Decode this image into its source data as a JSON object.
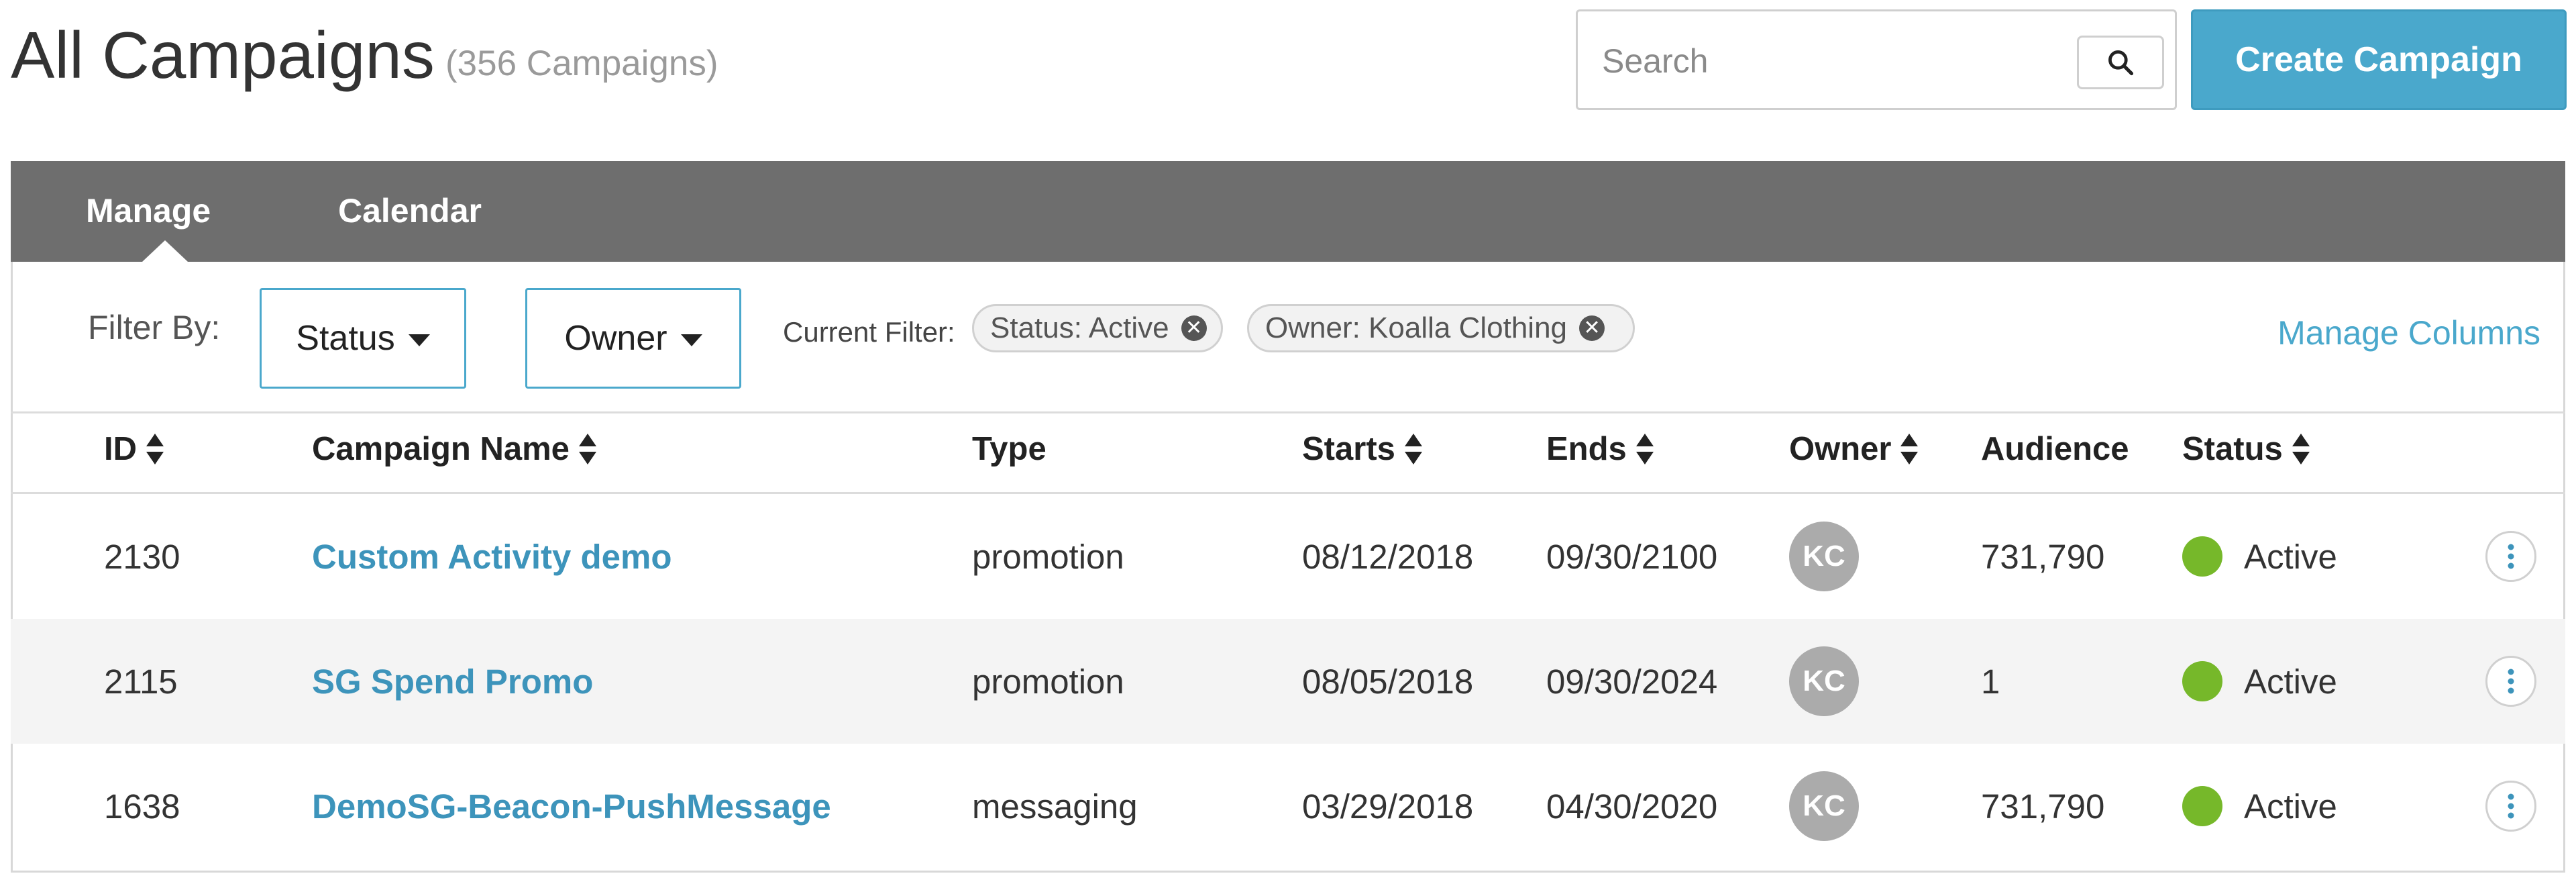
{
  "header": {
    "title": "All Campaigns",
    "count": "(356 Campaigns)",
    "search": {
      "placeholder": "Search",
      "value": "",
      "icon": "search-icon"
    },
    "create_label": "Create Campaign"
  },
  "tabs": [
    {
      "label": "Manage",
      "active": true
    },
    {
      "label": "Calendar",
      "active": false
    }
  ],
  "filter": {
    "label": "Filter By:",
    "status_label": "Status",
    "owner_label": "Owner",
    "current_label": "Current Filter:",
    "chips": [
      {
        "label": "Status: Active"
      },
      {
        "label": "Owner: Koalla Clothing"
      }
    ],
    "manage_columns": "Manage Columns"
  },
  "table": {
    "columns": [
      {
        "label": "ID",
        "sortable": true
      },
      {
        "label": "Campaign Name",
        "sortable": true
      },
      {
        "label": "Type",
        "sortable": false
      },
      {
        "label": "Starts",
        "sortable": true
      },
      {
        "label": "Ends",
        "sortable": true
      },
      {
        "label": "Owner",
        "sortable": true
      },
      {
        "label": "Audience",
        "sortable": false
      },
      {
        "label": "Status",
        "sortable": true
      }
    ],
    "rows": [
      {
        "id": "2130",
        "name": "Custom Activity demo",
        "type": "promotion",
        "starts": "08/12/2018",
        "ends": "09/30/2100",
        "owner": "KC",
        "audience": "731,790",
        "status": "Active"
      },
      {
        "id": "2115",
        "name": "SG Spend Promo",
        "type": "promotion",
        "starts": "08/05/2018",
        "ends": "09/30/2024",
        "owner": "KC",
        "audience": "1",
        "status": "Active"
      },
      {
        "id": "1638",
        "name": "DemoSG-Beacon-PushMessage",
        "type": "messaging",
        "starts": "03/29/2018",
        "ends": "04/30/2020",
        "owner": "KC",
        "audience": "731,790",
        "status": "Active"
      }
    ]
  },
  "colors": {
    "accent": "#4aa8cc",
    "link": "#3d94bb",
    "tabbar": "#6e6e6e",
    "status_active": "#76b82a",
    "avatar": "#ababab"
  }
}
